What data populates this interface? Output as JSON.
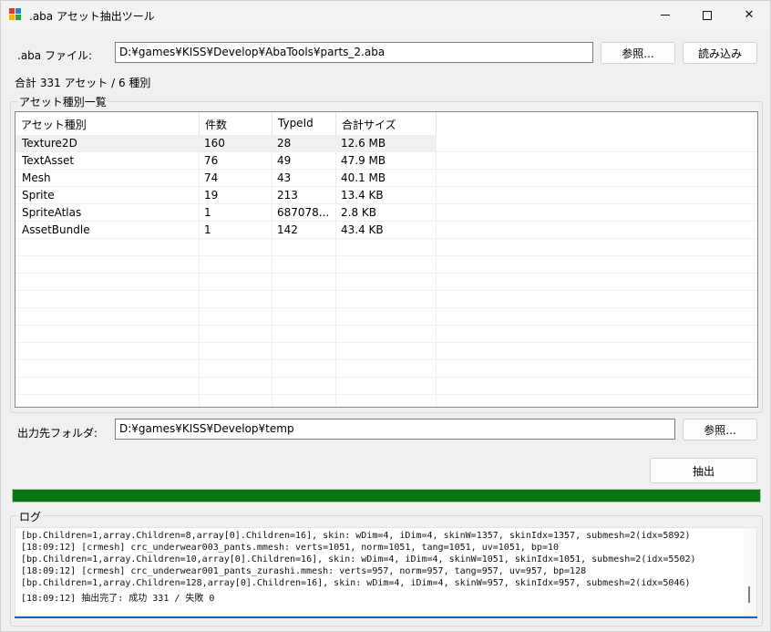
{
  "window": {
    "title": ".aba アセット抽出ツール",
    "minimize_glyph": "—",
    "maximize_glyph": "☐",
    "close_glyph": "✕",
    "icon": "app-icon"
  },
  "file": {
    "label": ".aba ファイル:",
    "path": "D:¥games¥KISS¥Develop¥AbaTools¥parts_2.aba",
    "browse_label": "参照...",
    "load_label": "読み込み"
  },
  "summary": "合計 331 アセット / 6 種別",
  "asset_list": {
    "group_title": "アセット種別一覧",
    "columns": [
      "アセット種別",
      "件数",
      "TypeId",
      "合計サイズ"
    ],
    "rows": [
      {
        "type": "Texture2D",
        "count": "160",
        "typeid": "28",
        "size": "12.6 MB"
      },
      {
        "type": "TextAsset",
        "count": "76",
        "typeid": "49",
        "size": "47.9 MB"
      },
      {
        "type": "Mesh",
        "count": "74",
        "typeid": "43",
        "size": "40.1 MB"
      },
      {
        "type": "Sprite",
        "count": "19",
        "typeid": "213",
        "size": "13.4 KB"
      },
      {
        "type": "SpriteAtlas",
        "count": "1",
        "typeid": "687078...",
        "size": "2.8 KB"
      },
      {
        "type": "AssetBundle",
        "count": "1",
        "typeid": "142",
        "size": "43.4 KB"
      }
    ],
    "selected_index": 0
  },
  "output": {
    "label": "出力先フォルダ:",
    "path": "D:¥games¥KISS¥Develop¥temp",
    "browse_label": "参照..."
  },
  "extract_label": "抽出",
  "progress": {
    "value_percent": 100,
    "color": "#06780f"
  },
  "log": {
    "title": "ログ",
    "lines": [
      "[bp.Children=1,array.Children=8,array[0].Children=16], skin: wDim=4, iDim=4, skinW=1357, skinIdx=1357, submesh=2(idx=5892)",
      "[18:09:12] [crmesh] crc_underwear003_pants.mmesh: verts=1051, norm=1051, tang=1051, uv=1051, bp=10",
      "[bp.Children=1,array.Children=10,array[0].Children=16], skin: wDim=4, iDim=4, skinW=1051, skinIdx=1051, submesh=2(idx=5502)",
      "[18:09:12] [crmesh] crc_underwear001_pants_zurashi.mmesh: verts=957, norm=957, tang=957, uv=957, bp=128",
      "[bp.Children=1,array.Children=128,array[0].Children=16], skin: wDim=4, iDim=4, skinW=957, skinIdx=957, submesh=2(idx=5046)",
      "[18:09:12] 抽出完了: 成功 331 / 失敗 0"
    ]
  }
}
